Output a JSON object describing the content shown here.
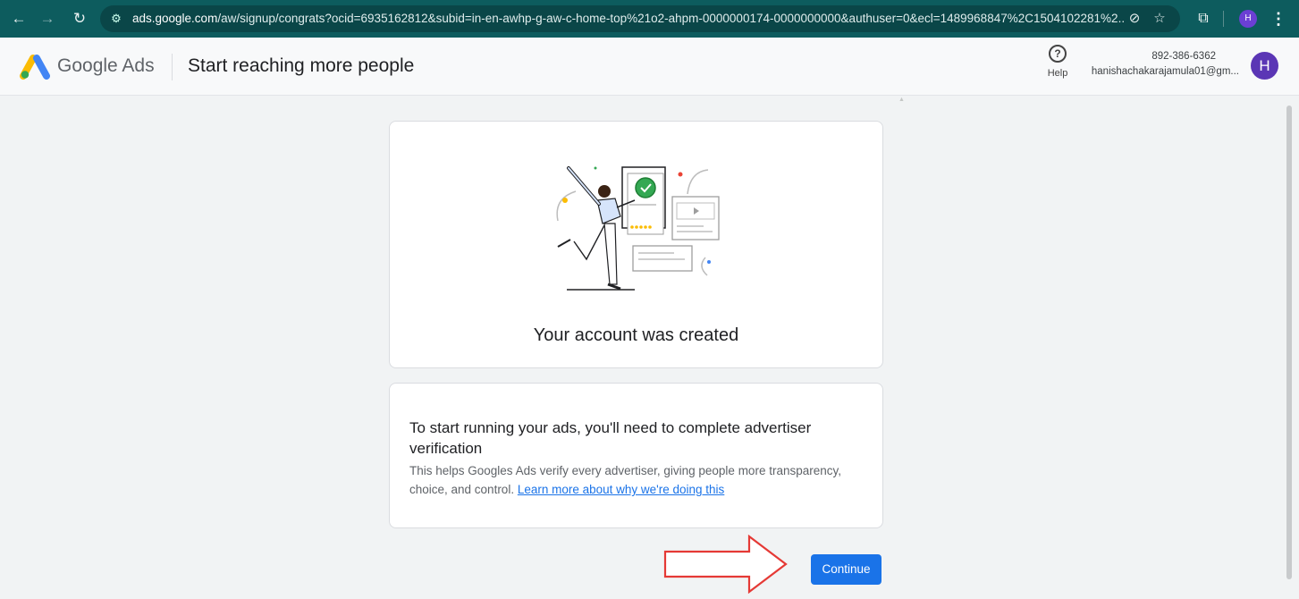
{
  "browser": {
    "url_host": "ads.google.com",
    "url_path": "/aw/signup/congrats?ocid=6935162812&subid=in-en-awhp-g-aw-c-home-top%21o2-ahpm-0000000174-0000000000&authuser=0&ecl=1489968847%2C1504102281%2...",
    "profile_initial": "H",
    "icons": [
      "back-icon",
      "forward-icon",
      "reload-icon",
      "site-info-icon",
      "eye-off-icon",
      "star-icon",
      "extension-icon",
      "kebab-menu-icon"
    ]
  },
  "header": {
    "brand": "Google Ads",
    "title": "Start reaching more people",
    "help_label": "Help",
    "account_phone": "892-386-6362",
    "account_email": "hanishachakarajamula01@gm...",
    "avatar_initial": "H"
  },
  "main": {
    "created_text": "Your account was created",
    "verify_title": "To start running your ads, you'll need to complete advertiser verification",
    "verify_body": "This helps Googles Ads verify every advertiser, giving people more transparency, choice, and control.",
    "verify_link": "Learn more about why we're doing this",
    "continue_label": "Continue"
  },
  "colors": {
    "chrome_bg": "#0d5c5e",
    "primary": "#1a73e8",
    "annotation_arrow": "#e53935",
    "success_green": "#34a853"
  }
}
